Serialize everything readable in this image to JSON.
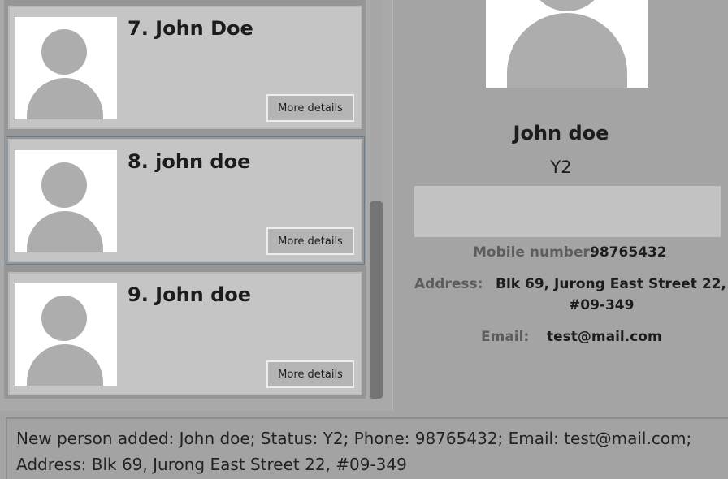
{
  "people": [
    {
      "title": "7. John Doe",
      "button": "More details"
    },
    {
      "title": "8. john doe",
      "button": "More details"
    },
    {
      "title": "9. John doe",
      "button": "More details"
    }
  ],
  "detail": {
    "name": "John doe",
    "status": "Y2",
    "mobile_label": "Mobile number:",
    "mobile_value": "98765432",
    "address_label": "Address:",
    "address_line1": "Blk 69, Jurong East Street 22,",
    "address_line2": "#09-349",
    "email_label": "Email:",
    "email_value": "test@mail.com"
  },
  "result": {
    "message": "New person added: John doe; Status: Y2; Phone: 98765432; Email: test@mail.com; Address: Blk 69, Jurong East Street 22, #09-349"
  }
}
